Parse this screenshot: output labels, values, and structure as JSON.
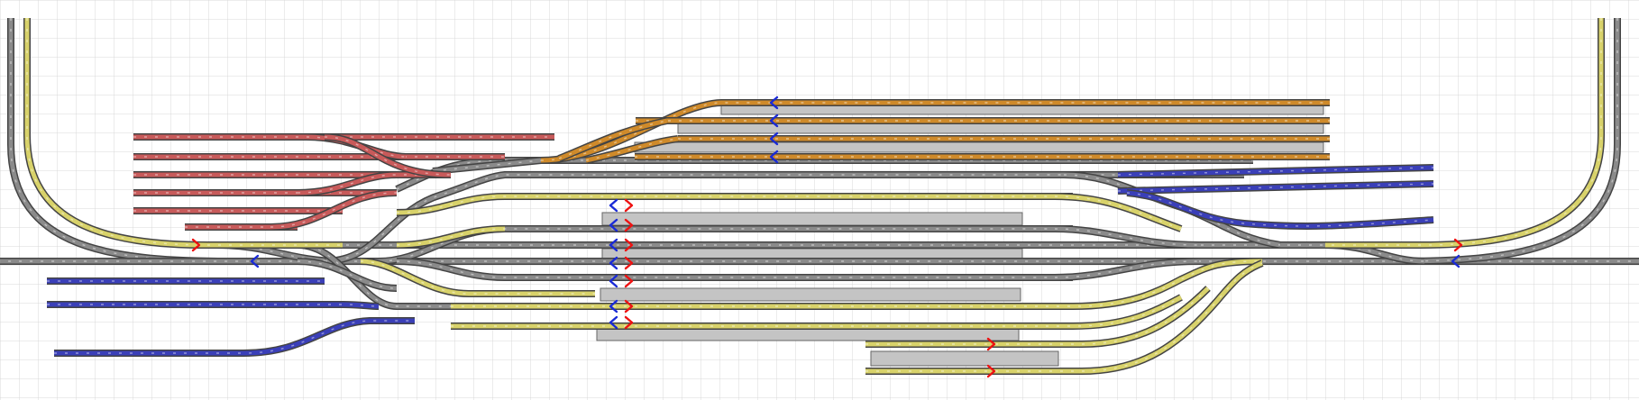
{
  "layout_editor": {
    "grid": true,
    "colors": {
      "background": "#ffffff",
      "grid_line": "#d8d8d8",
      "track_grey": "#8a8a8a",
      "track_yellow": "#d8d26a",
      "track_blue": "#3a3fb8",
      "track_red": "#c85a5a",
      "track_orange": "#cf8a2a",
      "platform": "#c4c4c4",
      "signal_red": "#ee1111",
      "signal_blue": "#1a2ad6"
    },
    "track_groups": [
      {
        "name": "grey-main-tracks",
        "color_key": "track_grey"
      },
      {
        "name": "yellow-station-tracks",
        "color_key": "track_yellow"
      },
      {
        "name": "blue-sidings-right",
        "color_key": "track_blue"
      },
      {
        "name": "blue-sidings-left",
        "color_key": "track_blue"
      },
      {
        "name": "red-yard-sidings",
        "color_key": "track_red"
      },
      {
        "name": "orange-yard-sidings",
        "color_key": "track_orange"
      }
    ],
    "platform_count": 7,
    "signal_count": 24
  }
}
